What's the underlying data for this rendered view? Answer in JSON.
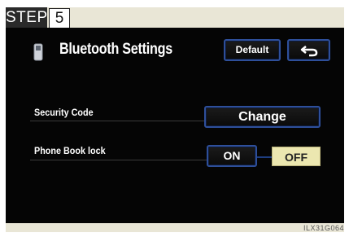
{
  "step": {
    "label": "STEP",
    "number": "5"
  },
  "header": {
    "title": "Bluetooth Settings",
    "default_label": "Default",
    "back_icon": "return-arrow-icon"
  },
  "rows": {
    "security_code": {
      "label": "Security Code",
      "button_label": "Change"
    },
    "phone_book_lock": {
      "label": "Phone Book lock",
      "on_label": "ON",
      "off_label": "OFF",
      "selected": "OFF"
    }
  },
  "footer": {
    "code": "ILX31G064"
  },
  "colors": {
    "button_border": "#2e4f9a",
    "selected_fill": "#ece7b0",
    "screen": "#050505",
    "frame": "#e9e6d6"
  }
}
